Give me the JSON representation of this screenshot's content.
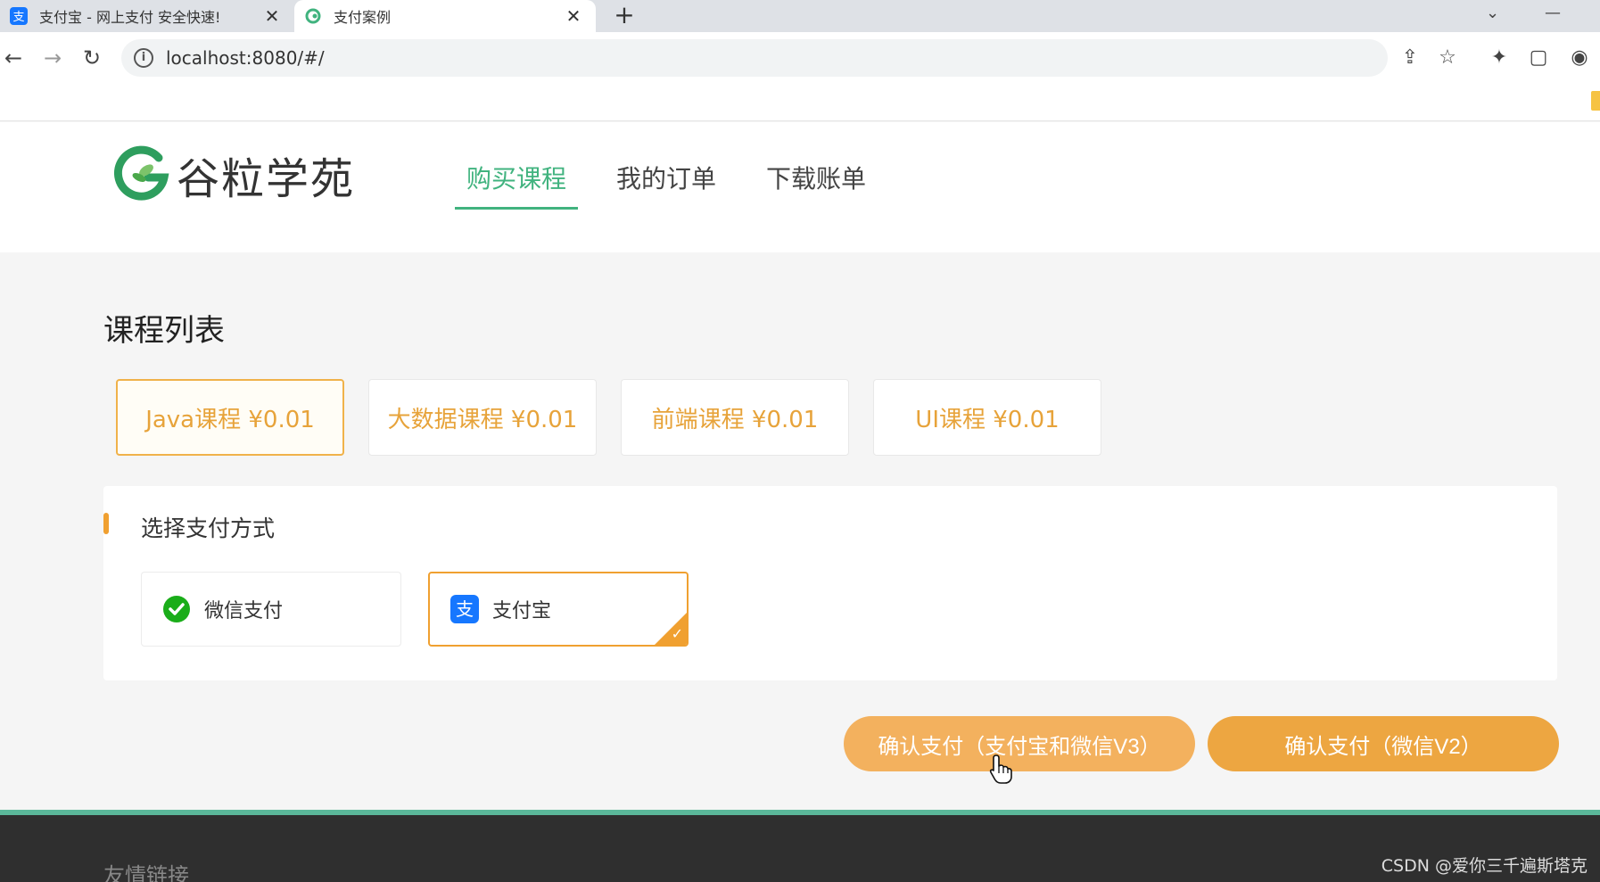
{
  "browser": {
    "tabs": [
      {
        "title": "支付宝 - 网上支付 安全快速!",
        "favicon": "alipay-icon",
        "active": false
      },
      {
        "title": "支付案例",
        "favicon": "guli-logo-icon",
        "active": true
      }
    ],
    "url": "localhost:8080/#/"
  },
  "header": {
    "logo_text": "谷粒学苑",
    "nav": [
      {
        "label": "购买课程",
        "active": true
      },
      {
        "label": "我的订单",
        "active": false
      },
      {
        "label": "下载账单",
        "active": false
      }
    ]
  },
  "main": {
    "section_title": "课程列表",
    "courses": [
      {
        "label": "Java课程 ¥0.01",
        "selected": true
      },
      {
        "label": "大数据课程 ¥0.01",
        "selected": false
      },
      {
        "label": "前端课程 ¥0.01",
        "selected": false
      },
      {
        "label": "UI课程 ¥0.01",
        "selected": false
      }
    ],
    "payment": {
      "title": "选择支付方式",
      "methods": [
        {
          "label": "微信支付",
          "icon": "wechat-pay-icon",
          "selected": false
        },
        {
          "label": "支付宝",
          "icon": "alipay-icon",
          "selected": true
        }
      ]
    },
    "buttons": {
      "confirm_v3": "确认支付（支付宝和微信V3）",
      "confirm_v2": "确认支付（微信V2）"
    }
  },
  "footer": {
    "title": "友情链接",
    "watermark": "CSDN @爱你三千遍斯塔克"
  },
  "colors": {
    "brand_green": "#41b37f",
    "accent_orange": "#f0a030",
    "course_text": "#e7a33a",
    "footer_bg": "#2f2f2f"
  }
}
